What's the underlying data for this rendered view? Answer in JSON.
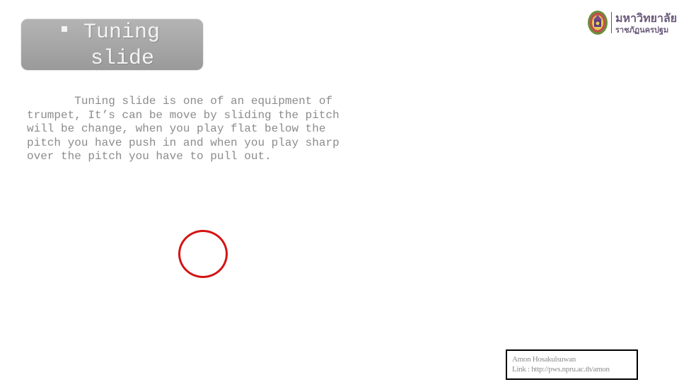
{
  "title": {
    "bullet_icon": "square-bullet-icon",
    "line1": "Tuning",
    "line2": "slide"
  },
  "body": {
    "paragraph_lines": [
      "       Tuning slide is one of an equipment of",
      "trumpet, It’s can be move by sliding the pitch",
      "will be change, when you play flat below the",
      "pitch you have push in and when you play sharp",
      "over the pitch you have to pull out."
    ]
  },
  "logo": {
    "icon": "university-emblem-icon",
    "line1": "มหาวิทยาลัย",
    "line2": "ราชภัฏนครปฐม"
  },
  "annotation": {
    "shape": "red-circle",
    "color": "#d41414"
  },
  "credit": {
    "name": "Amon Hosakulsuwan",
    "link": "Link : http://pws.npru.ac.th/amon"
  }
}
